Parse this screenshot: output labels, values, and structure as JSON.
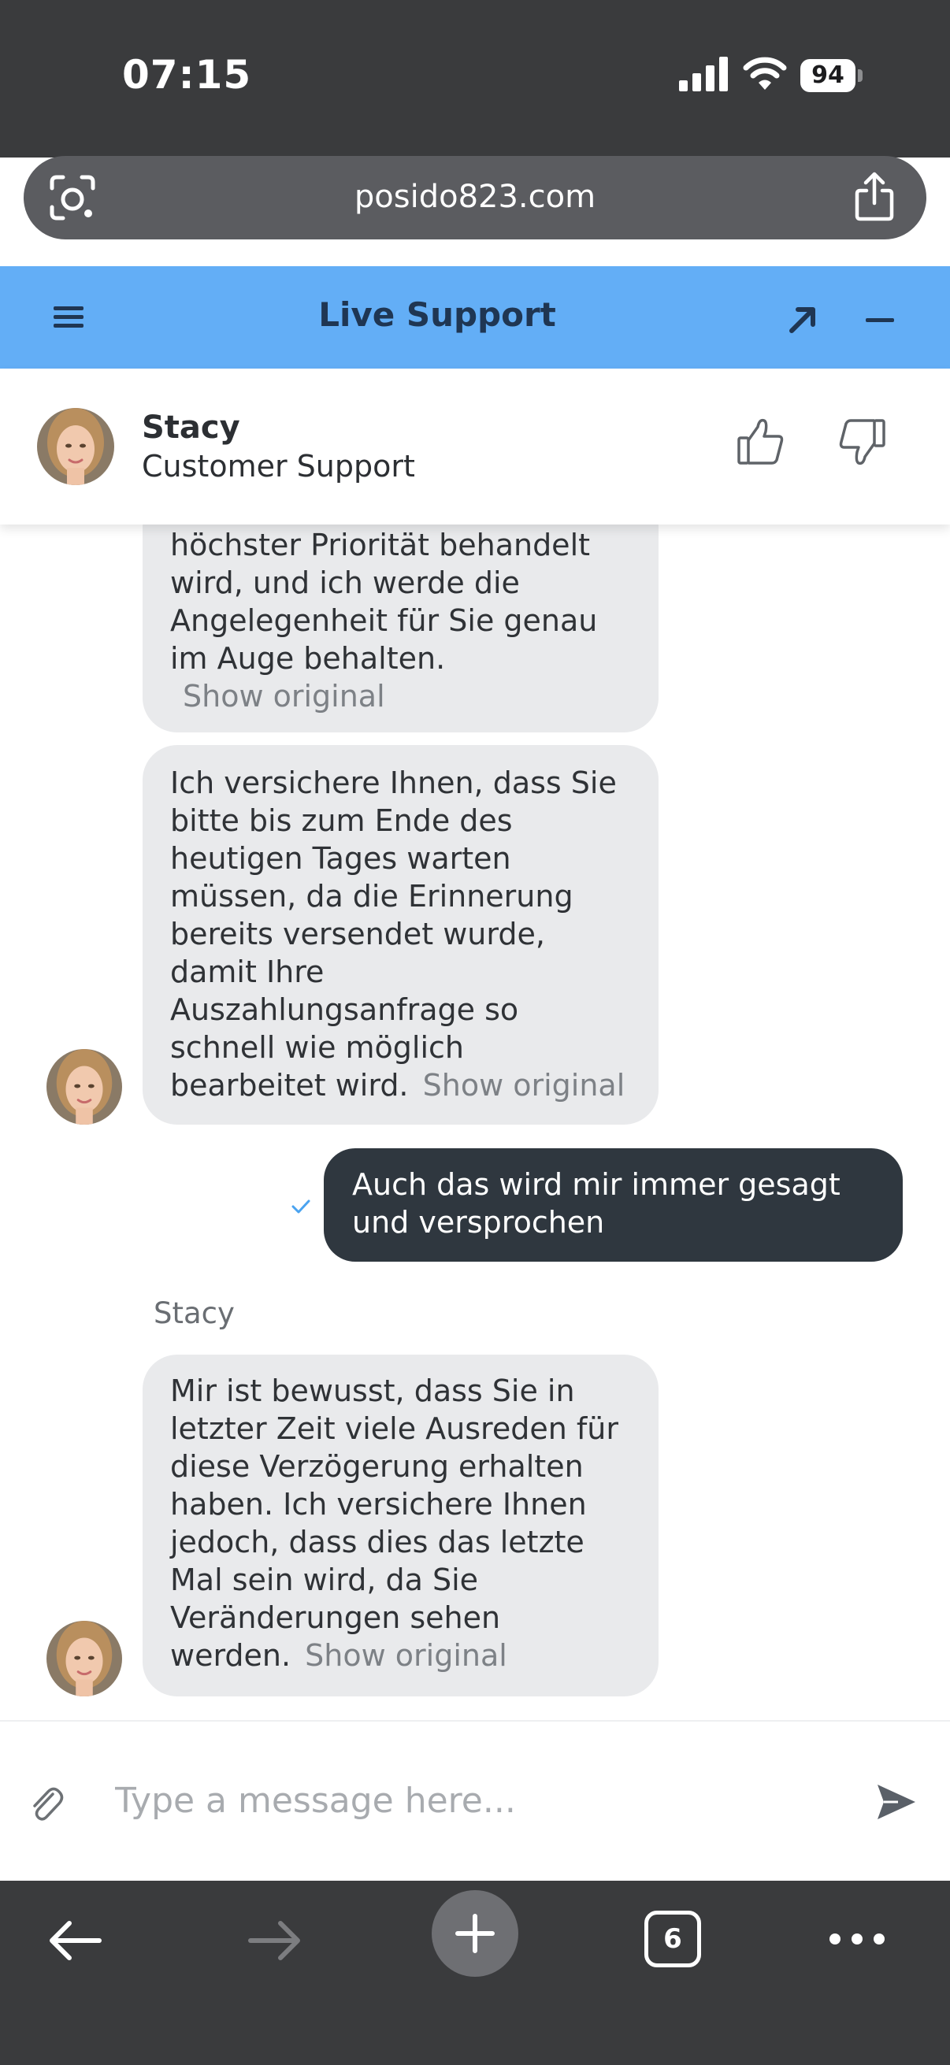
{
  "status_bar": {
    "time": "07:15",
    "battery": "94"
  },
  "browser": {
    "url": "posido823.com",
    "tab_count": "6"
  },
  "widget": {
    "title": "Live Support",
    "agent": {
      "name": "Stacy",
      "role": "Customer Support"
    }
  },
  "messages": [
    {
      "text": "höchster Priorität behandelt\nwird, und ich werde die\nAngelegenheit für Sie genau\nim Auge behalten.",
      "show_original": "Show original"
    },
    {
      "text": "Ich versichere Ihnen, dass Sie\nbitte bis zum Ende des\nheutigen Tages warten\nmüssen, da die Erinnerung\nbereits versendet wurde,\ndamit Ihre\nAuszahlungsanfrage so\nschnell wie möglich\nbearbeitet wird.",
      "show_original": "Show original"
    },
    {
      "text": "Auch das wird mir immer gesagt\nund versprochen"
    },
    {
      "sender": "Stacy",
      "text": "Mir ist bewusst, dass Sie in\nletzter Zeit viele Ausreden für\ndiese Verzögerung erhalten\nhaben. Ich versichere Ihnen\njedoch, dass dies das letzte\nMal sein wird, da Sie\nVeränderungen sehen\nwerden.",
      "show_original": "Show original"
    }
  ],
  "composer": {
    "placeholder": "Type a message here..."
  },
  "icons": {
    "status": [
      "signal-icon",
      "wifi-icon",
      "battery-icon"
    ],
    "browser": [
      "lens-icon",
      "share-icon",
      "back-icon",
      "forward-icon",
      "plus-icon",
      "tabs-icon",
      "more-icon"
    ],
    "widget": [
      "menu-icon",
      "expand-icon",
      "minimize-icon",
      "thumbs-up-icon",
      "thumbs-down-icon",
      "check-icon",
      "paperclip-icon",
      "send-icon"
    ]
  },
  "colors": {
    "header": "#63aef6",
    "header_title": "#1f3653",
    "incoming_bubble": "#e9eaec",
    "outgoing_bubble": "#2f373f",
    "read_check": "#4aa3f0",
    "browser_chrome": "#3a3b3d"
  }
}
